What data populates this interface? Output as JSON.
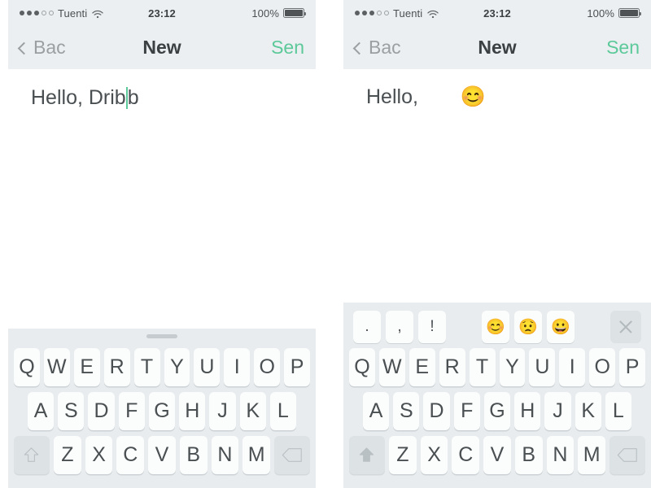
{
  "panels": [
    {
      "id": "panel-left",
      "statusbar": {
        "carrier": "Tuenti",
        "signal_filled": 3,
        "signal_empty": 2,
        "wifi_icon": "wifi-icon",
        "time": "23:12",
        "battery_percent": "100%",
        "battery_icon": "battery-full-icon"
      },
      "navbar": {
        "back_label": "Bac",
        "back_icon": "chevron-left-icon",
        "title": "New",
        "send_label": "Sen",
        "send_color": "#5cc99a"
      },
      "compose": {
        "text_before_caret": "Hello, Drib",
        "text_after_caret": "b",
        "caret_color": "#5cc99a",
        "emoji": ""
      },
      "keyboard": {
        "has_grabber": true,
        "has_suggestion_row": false,
        "suggestions": [],
        "emoji_suggestions": [],
        "close_icon": "",
        "row1": [
          "Q",
          "W",
          "E",
          "R",
          "T",
          "Y",
          "U",
          "I",
          "O",
          "P"
        ],
        "row2": [
          "A",
          "S",
          "D",
          "F",
          "G",
          "H",
          "J",
          "K",
          "L"
        ],
        "row3": [
          "Z",
          "X",
          "C",
          "V",
          "B",
          "N",
          "M"
        ],
        "shift_icon": "shift-outline-icon",
        "shift_active": false,
        "backspace_icon": "backspace-icon"
      }
    },
    {
      "id": "panel-right",
      "statusbar": {
        "carrier": "Tuenti",
        "signal_filled": 3,
        "signal_empty": 2,
        "wifi_icon": "wifi-icon",
        "time": "23:12",
        "battery_percent": "100%",
        "battery_icon": "battery-full-icon"
      },
      "navbar": {
        "back_label": "Bac",
        "back_icon": "chevron-left-icon",
        "title": "New",
        "send_label": "Sen",
        "send_color": "#5cc99a"
      },
      "compose": {
        "text_before_caret": "Hello,",
        "text_after_caret": "",
        "caret_color": "#5cc99a",
        "emoji": "😊"
      },
      "keyboard": {
        "has_grabber": false,
        "has_suggestion_row": true,
        "suggestions": [
          ".",
          ",",
          "!"
        ],
        "emoji_suggestions": [
          "😊",
          "😟",
          "😀"
        ],
        "close_icon": "close-x-icon",
        "row1": [
          "Q",
          "W",
          "E",
          "R",
          "T",
          "Y",
          "U",
          "I",
          "O",
          "P"
        ],
        "row2": [
          "A",
          "S",
          "D",
          "F",
          "G",
          "H",
          "J",
          "K",
          "L"
        ],
        "row3": [
          "Z",
          "X",
          "C",
          "V",
          "B",
          "N",
          "M"
        ],
        "shift_icon": "shift-solid-icon",
        "shift_active": true,
        "backspace_icon": "backspace-icon"
      }
    }
  ],
  "theme": {
    "chrome_bg": "#eceff1",
    "keyboard_bg": "#e8ecee",
    "key_bg": "#fbfcfc",
    "mod_key_bg": "#dde2e5",
    "text_color": "#4a4f52",
    "accent": "#5cc99a"
  }
}
